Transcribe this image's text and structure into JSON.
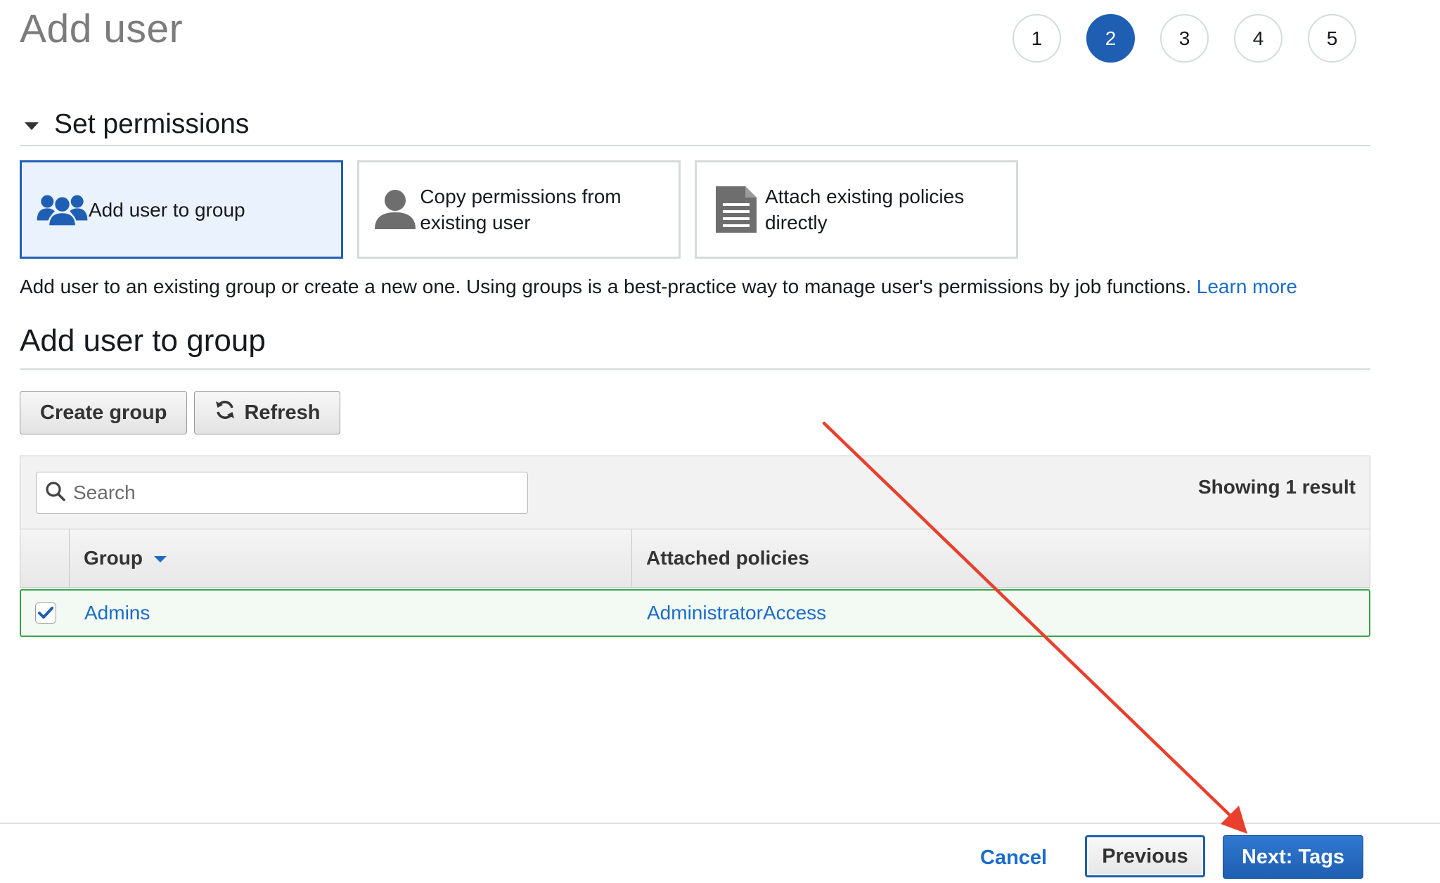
{
  "page": {
    "title": "Add user"
  },
  "steps": [
    "1",
    "2",
    "3",
    "4",
    "5"
  ],
  "active_step": "2",
  "section": {
    "title": "Set permissions"
  },
  "options": [
    {
      "label": "Add user to group",
      "icon": "user-group-icon",
      "selected": true
    },
    {
      "label": "Copy permissions from existing user",
      "icon": "user-icon",
      "selected": false
    },
    {
      "label": "Attach existing policies directly",
      "icon": "document-icon",
      "selected": false
    }
  ],
  "description": {
    "text": "Add user to an existing group or create a new one. Using groups is a best-practice way to manage user's permissions by job functions.",
    "link": "Learn more"
  },
  "group_section": {
    "title": "Add user to group",
    "create_label": "Create group",
    "refresh_label": "Refresh"
  },
  "table": {
    "search_placeholder": "Search",
    "result_count": "Showing 1 result",
    "columns": [
      "Group",
      "Attached policies"
    ],
    "rows": [
      {
        "group": "Admins",
        "policies": "AdministratorAccess",
        "checked": true
      }
    ]
  },
  "footer": {
    "cancel": "Cancel",
    "previous": "Previous",
    "next": "Next: Tags"
  },
  "colors": {
    "primary": "#1f5fb3",
    "link": "#1a6ccb",
    "selected_row_border": "#37a448",
    "annotation_arrow": "#e8402d"
  }
}
